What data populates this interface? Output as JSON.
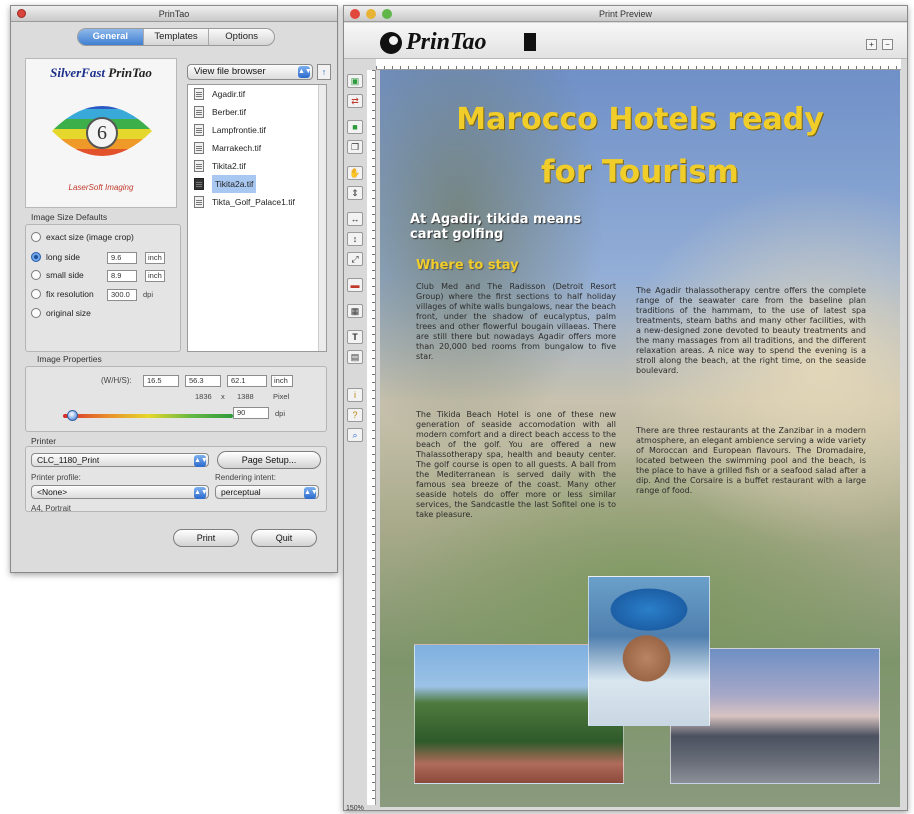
{
  "printao": {
    "title": "PrinTao",
    "tabs": [
      "General",
      "Templates",
      "Options"
    ],
    "logo": {
      "brand1": "SilverFast",
      "brand2": " PrinTao",
      "number": "6",
      "sub": "LaserSoft Imaging"
    },
    "browser_select": "View file browser",
    "files": [
      "Agadir.tif",
      "Berber.tif",
      "Lampfrontie.tif",
      "Marrakech.tif",
      "Tikita2.tif",
      "Tikita2a.tif",
      "Tikta_Golf_Palace1.tif"
    ],
    "image_size": {
      "label": "Image Size Defaults",
      "options": [
        "exact size (image crop)",
        "long side",
        "small side",
        "fix resolution",
        "original size"
      ],
      "long_value": "9.6",
      "small_value": "8.9",
      "res_value": "300.0",
      "unit_inch": "inch",
      "unit_dpi": "dpi"
    },
    "image_props": {
      "label": "Image Properties",
      "dims_label": "(W/H/S):",
      "w": "16.5",
      "h": "56.3",
      "s": "62.1",
      "unit": "inch",
      "px_w": "1836",
      "px_x": "x",
      "px_h": "1388",
      "px_unit": "Pixel",
      "dpi_value": "90",
      "dpi_unit": "dpi",
      "slider_fraction": 0.05
    },
    "printer": {
      "label": "Printer",
      "name": "CLC_1180_Print",
      "page_setup": "Page Setup...",
      "profile_label": "Printer profile:",
      "profile_value": "<None>",
      "intent_label": "Rendering intent:",
      "intent_value": "perceptual",
      "paper": "A4, Portrait"
    },
    "buttons": {
      "print": "Print",
      "quit": "Quit"
    }
  },
  "preview": {
    "title": "Print Preview",
    "brand": "PrinTao",
    "zoom": "150%",
    "headline1": "Marocco Hotels ready",
    "headline2": "for Tourism",
    "sub1": "At Agadir, tikida means",
    "sub2": "carat golfing",
    "where": "Where to stay",
    "body_left": "Club Med and The Radisson (Detroit Resort Group) where the first sections to half holiday villages of white walls bungalows, near the beach front, under the shadow of eucalyptus, palm trees and other flowerful bougain villaeas. There are still there but nowadays Agadir offers more than 20,000 bed rooms from bungalow to five star.",
    "body_left2": "The Tikida Beach Hotel is one of these new generation of seaside accomodation with all modern comfort and a direct beach access to the beach of the golf. You are offered a new Thalassotherapy spa, health and beauty center. The golf course is open to all guests. A ball from the Mediterranean is served daily with the famous sea breeze of the coast. Many other seaside hotels do offer more or less similar services, the Sandcastle the last Sofitel one is to take pleasure.",
    "body_right": "The Agadir thalassotherapy centre offers the complete range of the seawater care from the baseline plan traditions of the hammam, to the use of latest spa treatments, steam baths and many other facilities, with a new-designed zone devoted to beauty treatments and the many massages from all traditions, and the different relaxation areas. A nice way to spend the evening is a stroll along the beach, at the right time, on the seaside boulevard.",
    "body_right2": "There are three restaurants at the Zanzibar in a modern atmosphere, an elegant ambience serving a wide variety of Moroccan and European flavours. The Dromadaire, located between the swimming pool and the beach, is the place to have a grilled fish or a seafood salad after a dip. And the Corsaire is a buffet restaurant with a large range of food."
  }
}
